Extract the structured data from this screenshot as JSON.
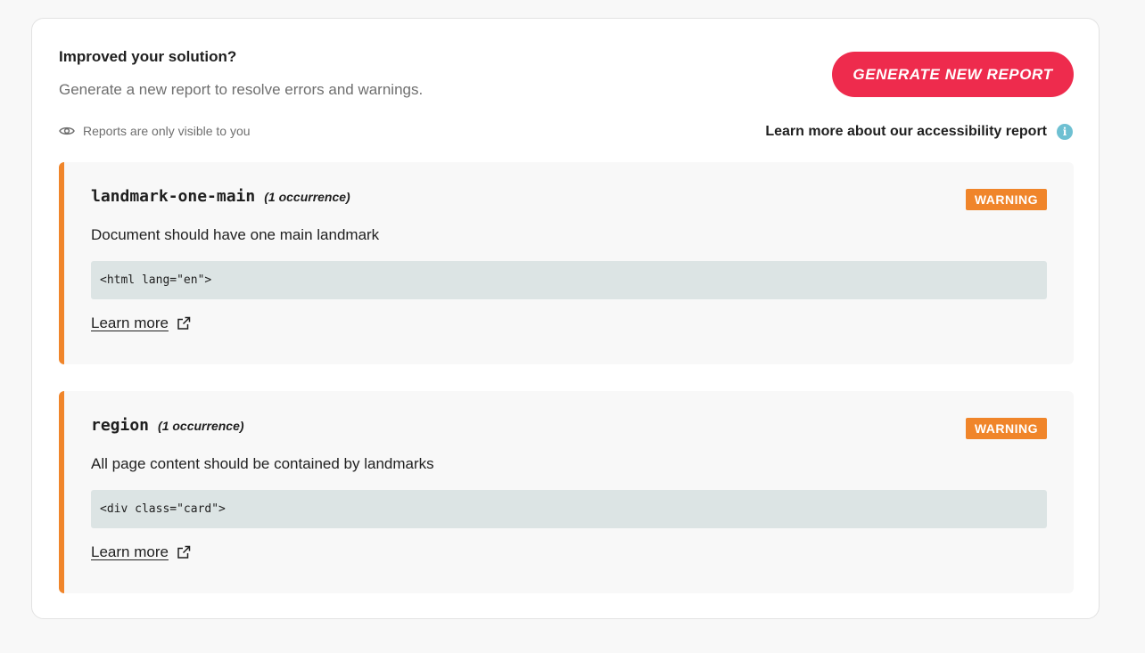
{
  "header": {
    "title": "Improved your solution?",
    "subtitle": "Generate a new report to resolve errors and warnings.",
    "generate_button": "Generate new report",
    "visibility_note": "Reports are only visible to you",
    "learn_more_report": "Learn more about our accessibility report"
  },
  "issues": [
    {
      "rule": "landmark-one-main",
      "occurrences": "(1 occurrence)",
      "severity": "WARNING",
      "description": "Document should have one main landmark",
      "code": "<html lang=\"en\">",
      "learn_more": "Learn more"
    },
    {
      "rule": "region",
      "occurrences": "(1 occurrence)",
      "severity": "WARNING",
      "description": "All page content should be contained by landmarks",
      "code": "<div class=\"card\">",
      "learn_more": "Learn more"
    }
  ],
  "colors": {
    "accent": "#ee2b4d",
    "warning": "#f0852a",
    "info": "#6ec0d2",
    "code_bg": "#dce4e4"
  },
  "icons": {
    "visibility": "eye-icon",
    "info": "info-icon",
    "external_link": "external-link-icon"
  }
}
